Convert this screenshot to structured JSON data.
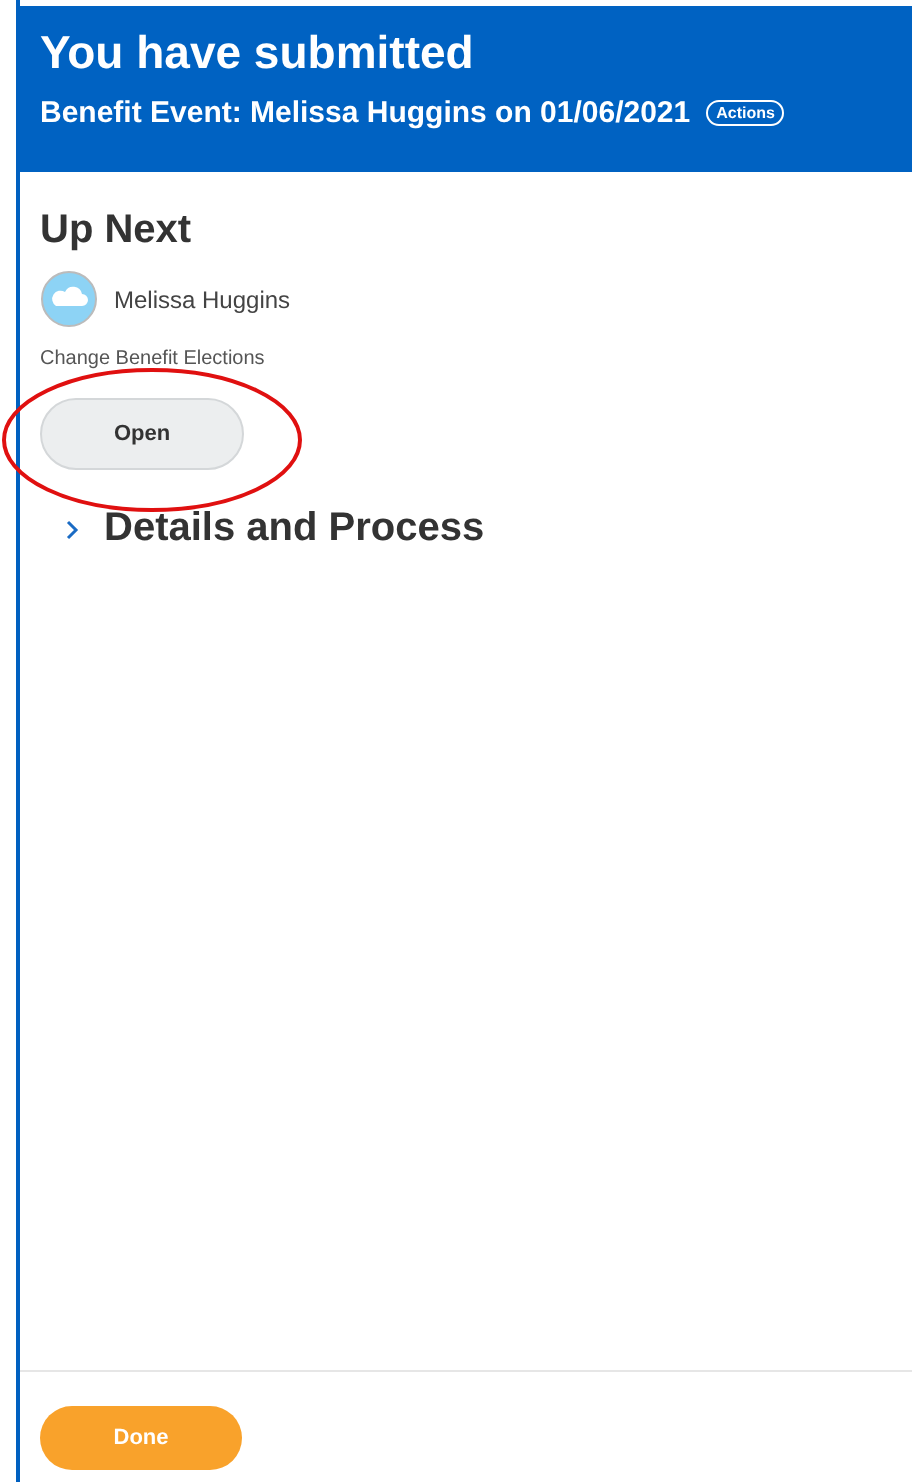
{
  "header": {
    "title": "You have submitted",
    "subtitle": "Benefit Event: Melissa Huggins on 01/06/2021",
    "actions_label": "Actions"
  },
  "up_next": {
    "heading": "Up Next",
    "person": "Melissa Huggins",
    "task": "Change Benefit Elections",
    "button": "Open"
  },
  "annotations": [
    {
      "kind": "ellipse"
    }
  ],
  "sections": [
    {
      "label": "Details and Process",
      "expanded": false
    }
  ],
  "footer": {
    "button": "Done"
  }
}
